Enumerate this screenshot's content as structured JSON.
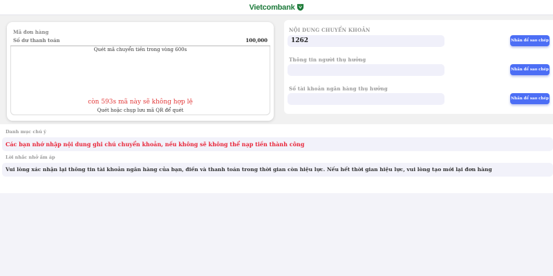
{
  "header": {
    "logo_text": "Vietcombank",
    "logo_icon": "vietcombank-shield-icon"
  },
  "order": {
    "order_label": "Mã đơn hàng",
    "amount_label": "Số dư thanh toán",
    "amount_value": "100,000",
    "qr_title": "Quét mã chuyển tiền trong vòng 600s",
    "expire_text": "còn 593s mã này sẽ không hợp lệ",
    "save_qr_text": "Quét hoặc chụp lưu mã QR để quét"
  },
  "transfer": {
    "content_label": "NỘI DUNG CHUYỂN KHOẢN",
    "content_value": "1262",
    "receiver_label": "Thông tin người thụ hưởng",
    "receiver_value": "",
    "account_label": "Số tài khoản ngân hàng thụ hưởng",
    "account_value": "",
    "copy_label": "Nhấn để sao chép"
  },
  "notes": {
    "category_label": "Danh mục chú ý",
    "warning_text": "Các bạn nhớ nhập nội dung ghi chú chuyển khoản, nếu không sẽ không thể nạp tiền thành công",
    "reminder_label": "Lời nhắc nhở ấm áp",
    "reminder_text": "Vui lòng xác nhận lại thông tin tài khoản ngân hàng của bạn, điền và thanh toán trong thời gian còn hiệu lực. Nếu hết thời gian hiệu lực, vui lòng tạo mới lại đơn hàng"
  },
  "colors": {
    "brand_green": "#1c7a3a",
    "button_blue": "#4c6ef5",
    "warning_red": "#e8273a"
  }
}
